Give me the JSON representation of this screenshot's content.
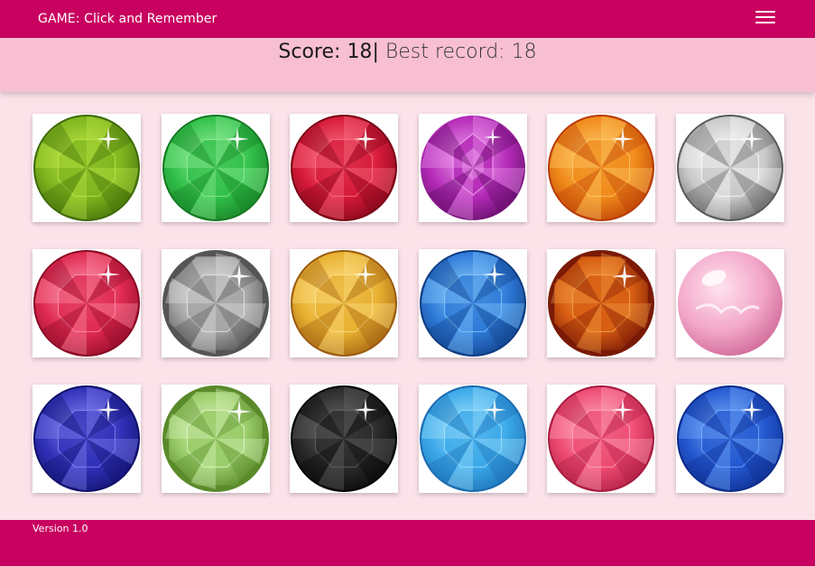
{
  "navbar": {
    "title": "GAME: Click and Remember",
    "menu_icon": "hamburger-menu-icon"
  },
  "scoreboard": {
    "score_label": "Score:",
    "score_value": "18",
    "separator": "|",
    "best_label": "Best record:",
    "best_value": "18"
  },
  "gems": [
    {
      "name": "green-gem-icon",
      "base": "#7fb51e",
      "light": "#c3ea4a",
      "dark": "#3e6b08",
      "shape": "round"
    },
    {
      "name": "emerald-gem-icon",
      "base": "#31c04a",
      "light": "#9bf0a0",
      "dark": "#157a22",
      "shape": "round"
    },
    {
      "name": "ruby-gem-icon",
      "base": "#d61a3a",
      "light": "#ff7a8c",
      "dark": "#7a0616",
      "shape": "round"
    },
    {
      "name": "purple-gem-icon",
      "base": "#b42bb8",
      "light": "#f2a0f0",
      "dark": "#5a0a5e",
      "shape": "faceted"
    },
    {
      "name": "orange-gem-icon",
      "base": "#f08a1a",
      "light": "#ffd070",
      "dark": "#b83a05",
      "shape": "round"
    },
    {
      "name": "diamond-gem-icon",
      "base": "#c9c9c9",
      "light": "#ffffff",
      "dark": "#5a5a5a",
      "shape": "round"
    },
    {
      "name": "pink-ruby-gem-icon",
      "base": "#e02a52",
      "light": "#ff9ab0",
      "dark": "#8a0a24",
      "shape": "round"
    },
    {
      "name": "silver-gem-icon",
      "base": "#a7a7a7",
      "light": "#e4e4e4",
      "dark": "#555555",
      "shape": "octagon"
    },
    {
      "name": "golden-gem-icon",
      "base": "#e8b030",
      "light": "#ffe590",
      "dark": "#9a5a10",
      "shape": "round"
    },
    {
      "name": "blue-gem-icon",
      "base": "#2e7ad8",
      "light": "#8fd0ff",
      "dark": "#0e3b82",
      "shape": "round"
    },
    {
      "name": "amber-gem-icon",
      "base": "#d85e12",
      "light": "#f4a44a",
      "dark": "#7a1a06",
      "shape": "octagon"
    },
    {
      "name": "pink-pearl-icon",
      "base": "#f2a6c8",
      "light": "#ffe3ef",
      "dark": "#d06a98",
      "shape": "pearl"
    },
    {
      "name": "sapphire-gem-icon",
      "base": "#3030b8",
      "light": "#8b8cf5",
      "dark": "#10106a",
      "shape": "round"
    },
    {
      "name": "pale-green-gem-icon",
      "base": "#9acd6a",
      "light": "#dff5c4",
      "dark": "#5a8a2a",
      "shape": "octagon"
    },
    {
      "name": "black-gem-icon",
      "base": "#2a2a2a",
      "light": "#6a6a6a",
      "dark": "#050505",
      "shape": "round"
    },
    {
      "name": "aquamarine-gem-icon",
      "base": "#3aa8e8",
      "light": "#a8e6ff",
      "dark": "#1a6ab0",
      "shape": "round"
    },
    {
      "name": "pink-tourmaline-gem-icon",
      "base": "#ee4a72",
      "light": "#ffb0c2",
      "dark": "#a81a3e",
      "shape": "round"
    },
    {
      "name": "blue-topaz-gem-icon",
      "base": "#2458d0",
      "light": "#7fb4ff",
      "dark": "#0c2a8a",
      "shape": "round"
    }
  ],
  "footer": {
    "version": "Version 1.0"
  }
}
